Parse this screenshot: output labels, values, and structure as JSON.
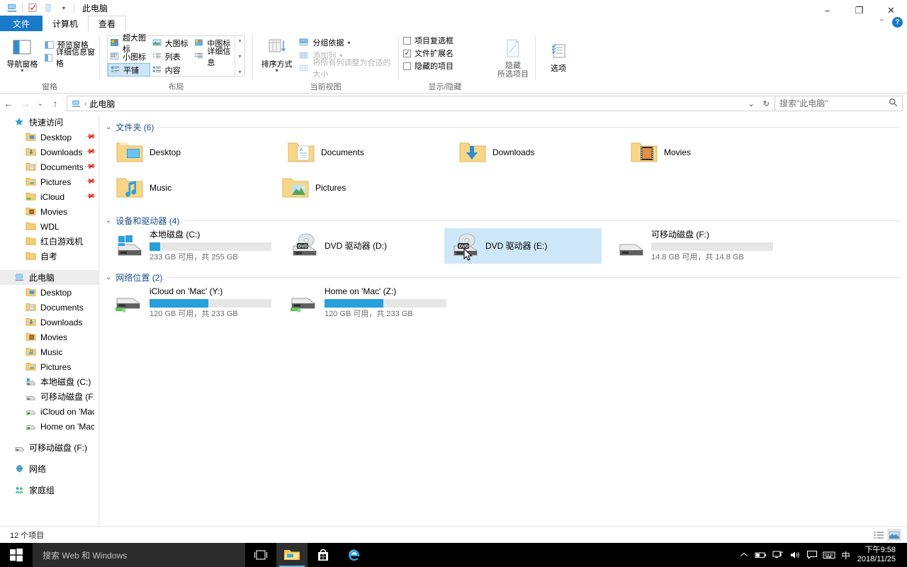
{
  "window": {
    "title": "此电脑",
    "quick_access": [
      "pc-icon",
      "properties-icon",
      "new-folder-icon",
      "customize-caret"
    ],
    "controls": {
      "minimize": "−",
      "maximize": "❐",
      "close": "✕"
    },
    "ribbon_collapse": "⌃",
    "help": "?"
  },
  "tabs": [
    {
      "id": "file",
      "label": "文件"
    },
    {
      "id": "computer",
      "label": "计算机"
    },
    {
      "id": "view",
      "label": "查看"
    }
  ],
  "ribbon": {
    "groups": [
      {
        "id": "panes",
        "label": "窗格",
        "big_button": {
          "label": "导航窗格",
          "caret": "▾"
        },
        "checks": [
          {
            "label": "预览窗格",
            "checked": false
          },
          {
            "label": "详细信息窗格",
            "checked": false
          }
        ]
      },
      {
        "id": "layout",
        "label": "布局",
        "items": [
          {
            "label": "超大图标",
            "selected": false
          },
          {
            "label": "大图标",
            "selected": false
          },
          {
            "label": "中图标",
            "selected": false
          },
          {
            "label": "小图标",
            "selected": false
          },
          {
            "label": "列表",
            "selected": false
          },
          {
            "label": "详细信息",
            "selected": false
          },
          {
            "label": "平铺",
            "selected": true
          },
          {
            "label": "内容",
            "selected": false
          }
        ],
        "scroll": [
          "▴",
          "▾",
          "▾"
        ]
      },
      {
        "id": "current-view",
        "label": "当前视图",
        "big_button": {
          "label": "排序方式",
          "caret": "▾"
        },
        "rows": [
          {
            "label": "分组依据",
            "caret": "▾",
            "disabled": false
          },
          {
            "label": "添加列",
            "caret": "▾",
            "disabled": true
          },
          {
            "label": "将所有列调整为合适的大小",
            "caret": "",
            "disabled": true
          }
        ]
      },
      {
        "id": "show-hide",
        "label": "显示/隐藏",
        "checks": [
          {
            "label": "项目复选框",
            "checked": false
          },
          {
            "label": "文件扩展名",
            "checked": true
          },
          {
            "label": "隐藏的项目",
            "checked": false
          }
        ],
        "big_button": {
          "label_line1": "隐藏",
          "label_line2": "所选项目"
        }
      },
      {
        "id": "options",
        "label": "",
        "big_button": {
          "label": "选项"
        }
      }
    ]
  },
  "address": {
    "back": "←",
    "forward": "→",
    "recent": "⌄",
    "up": "↑",
    "breadcrumb": [
      "此电脑"
    ],
    "separator": "›",
    "dropdown": "⌄",
    "refresh": "↻",
    "search_placeholder": "搜索\"此电脑\"",
    "search_value": ""
  },
  "sidebar": {
    "sections": [
      {
        "header": {
          "label": "快速访问",
          "icon": "star-icon"
        },
        "items": [
          {
            "label": "Desktop",
            "icon": "folder-desktop-icon",
            "pinned": true
          },
          {
            "label": "Downloads",
            "icon": "folder-downloads-icon",
            "pinned": true
          },
          {
            "label": "Documents",
            "icon": "folder-documents-icon",
            "pinned": true
          },
          {
            "label": "Pictures",
            "icon": "folder-pictures-icon",
            "pinned": true
          },
          {
            "label": "iCloud",
            "icon": "folder-icloud-icon",
            "pinned": true
          },
          {
            "label": "Movies",
            "icon": "folder-movies-icon",
            "pinned": false
          },
          {
            "label": "WDL",
            "icon": "folder-icon",
            "pinned": false
          },
          {
            "label": "红白游戏机",
            "icon": "folder-icon",
            "pinned": false
          },
          {
            "label": "自考",
            "icon": "folder-icon",
            "pinned": false
          }
        ]
      },
      {
        "header": {
          "label": "此电脑",
          "icon": "pc-icon",
          "selected": true
        },
        "items": [
          {
            "label": "Desktop",
            "icon": "folder-desktop-icon"
          },
          {
            "label": "Documents",
            "icon": "folder-documents-icon"
          },
          {
            "label": "Downloads",
            "icon": "folder-downloads-icon"
          },
          {
            "label": "Movies",
            "icon": "folder-movies-icon"
          },
          {
            "label": "Music",
            "icon": "folder-music-icon"
          },
          {
            "label": "Pictures",
            "icon": "folder-pictures-icon"
          },
          {
            "label": "本地磁盘 (C:)",
            "icon": "hdd-windows-icon"
          },
          {
            "label": "可移动磁盘 (F:)",
            "icon": "removable-drive-icon"
          },
          {
            "label": "iCloud on 'Mac' (Y:",
            "icon": "network-drive-icon"
          },
          {
            "label": "Home on 'Mac' (Z:",
            "icon": "network-drive-icon"
          }
        ]
      },
      {
        "header": {
          "label": "可移动磁盘 (F:)",
          "icon": "removable-drive-icon"
        },
        "items": []
      },
      {
        "header": {
          "label": "网络",
          "icon": "network-icon"
        },
        "items": []
      },
      {
        "header": {
          "label": "家庭组",
          "icon": "homegroup-icon"
        },
        "items": []
      }
    ]
  },
  "content": {
    "groups": [
      {
        "id": "folders",
        "title": "文件夹 (6)",
        "collapse": "⌄",
        "kind": "folder",
        "items": [
          {
            "name": "Desktop",
            "icon": "folder-desktop-icon"
          },
          {
            "name": "Documents",
            "icon": "folder-documents-icon"
          },
          {
            "name": "Downloads",
            "icon": "folder-downloads-icon"
          },
          {
            "name": "Movies",
            "icon": "folder-movies-icon"
          },
          {
            "name": "Music",
            "icon": "folder-music-icon"
          },
          {
            "name": "Pictures",
            "icon": "folder-pictures-icon"
          }
        ]
      },
      {
        "id": "devices",
        "title": "设备和驱动器 (4)",
        "collapse": "⌄",
        "kind": "drive",
        "items": [
          {
            "name": "本地磁盘 (C:)",
            "icon": "hdd-windows-icon",
            "capacity_text": "233 GB 可用，共 255 GB",
            "used_pct": 9,
            "has_bar": true,
            "selected": false
          },
          {
            "name": "DVD 驱动器 (D:)",
            "icon": "dvd-drive-icon",
            "capacity_text": "",
            "used_pct": 0,
            "has_bar": false,
            "selected": false
          },
          {
            "name": "DVD 驱动器 (E:)",
            "icon": "dvd-drive-icon",
            "capacity_text": "",
            "used_pct": 0,
            "has_bar": false,
            "selected": true
          },
          {
            "name": "可移动磁盘 (F:)",
            "icon": "removable-drive-icon",
            "capacity_text": "14.8 GB 可用，共 14.8 GB",
            "used_pct": 0,
            "has_bar": true,
            "selected": false
          }
        ]
      },
      {
        "id": "network",
        "title": "网络位置 (2)",
        "collapse": "⌄",
        "kind": "drive",
        "items": [
          {
            "name": "iCloud on 'Mac' (Y:)",
            "icon": "network-drive-icon",
            "capacity_text": "120 GB 可用，共 233 GB",
            "used_pct": 48,
            "has_bar": true,
            "selected": false
          },
          {
            "name": "Home on 'Mac' (Z:)",
            "icon": "network-drive-icon",
            "capacity_text": "120 GB 可用，共 233 GB",
            "used_pct": 48,
            "has_bar": true,
            "selected": false
          }
        ]
      }
    ]
  },
  "statusbar": {
    "item_count": "12 个项目",
    "view_buttons": [
      {
        "id": "details-view",
        "icon": "details-view-icon",
        "active": false
      },
      {
        "id": "large-icons-view",
        "icon": "large-icons-view-icon",
        "active": true
      }
    ]
  },
  "taskbar": {
    "start": "start-icon",
    "search_placeholder": "搜索 Web 和 Windows",
    "buttons": [
      {
        "id": "task-view",
        "icon": "task-view-icon",
        "active": false
      },
      {
        "id": "file-explorer",
        "icon": "file-explorer-icon",
        "active": true
      },
      {
        "id": "store",
        "icon": "store-icon",
        "active": false
      },
      {
        "id": "edge",
        "icon": "edge-icon",
        "active": false
      }
    ],
    "tray": [
      {
        "id": "show-hidden",
        "icon": "chevron-up-icon",
        "glyph": "⌃"
      },
      {
        "id": "battery",
        "icon": "battery-icon",
        "glyph": "▭"
      },
      {
        "id": "network",
        "icon": "network-tray-icon",
        "glyph": "🖳"
      },
      {
        "id": "volume",
        "icon": "volume-icon",
        "glyph": "🔊"
      },
      {
        "id": "action-center",
        "icon": "action-center-icon",
        "glyph": "🗩"
      },
      {
        "id": "keyboard",
        "icon": "keyboard-icon",
        "glyph": "⌨"
      },
      {
        "id": "ime",
        "icon": "ime-icon",
        "glyph": "中"
      }
    ],
    "clock": {
      "time": "下午9:58",
      "date": "2018/11/25"
    }
  },
  "colors": {
    "accent": "#1a79c8",
    "selection": "#cfe8f9",
    "bar_fill": "#26a0da",
    "group_title": "#1b4d8c",
    "taskbar": "#000000"
  }
}
